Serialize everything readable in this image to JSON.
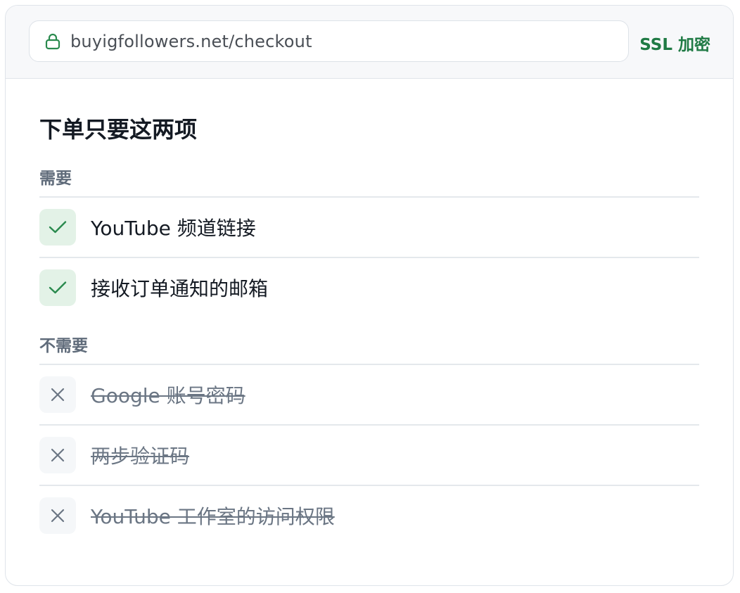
{
  "address_bar": {
    "url": "buyigfollowers.net/checkout",
    "security_label": "SSL 加密",
    "lock_icon": "lock-icon"
  },
  "main": {
    "title": "下单只要这两项",
    "required": {
      "label": "需要",
      "items": [
        {
          "text": "YouTube 频道链接",
          "icon": "check-icon"
        },
        {
          "text": "接收订单通知的邮箱",
          "icon": "check-icon"
        }
      ]
    },
    "not_required": {
      "label": "不需要",
      "items": [
        {
          "text": "Google 账号密码",
          "icon": "close-icon"
        },
        {
          "text": "两步验证码",
          "icon": "close-icon"
        },
        {
          "text": "YouTube 工作室的访问权限",
          "icon": "close-icon"
        }
      ]
    }
  },
  "colors": {
    "accent_green": "#1f7a44",
    "check_bg": "#e3f2e7",
    "muted_text": "#6b7684",
    "border": "#e4e8ec"
  }
}
